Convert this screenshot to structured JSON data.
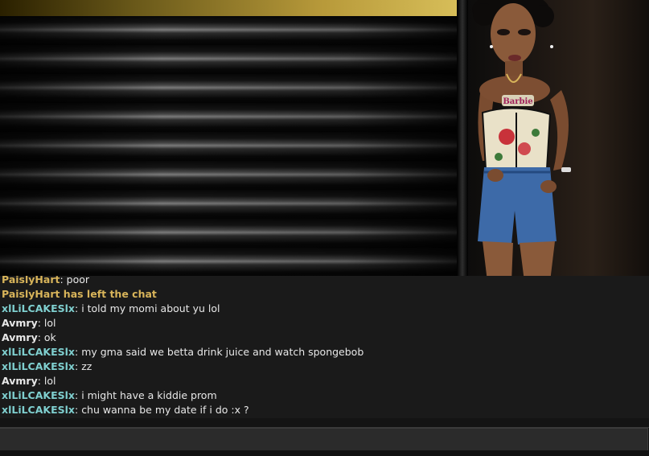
{
  "colors": {
    "name_xlil": "#7fcfcf",
    "name_avmry": "#e8e8e8",
    "name_paisly": "#d8b45a",
    "system": "#d8b45a",
    "message": "#e8e8e8"
  },
  "chat": {
    "messages": [
      {
        "name": "PaislyHart",
        "sep": ": ",
        "text": "poor",
        "color": "#d8b45a",
        "partial": true
      },
      {
        "system": "PaislyHart has left the chat"
      },
      {
        "name": "xlLiLCAKESlx",
        "sep": ": ",
        "text": "i told my momi about yu lol",
        "color": "#7fcfcf"
      },
      {
        "name": "Avmry",
        "sep": ": ",
        "text": "lol",
        "color": "#e8e8e8"
      },
      {
        "name": "Avmry",
        "sep": ": ",
        "text": "ok",
        "color": "#e8e8e8"
      },
      {
        "name": "xlLiLCAKESlx",
        "sep": ": ",
        "text": "my gma said we betta drink juice and watch spongebob",
        "color": "#7fcfcf"
      },
      {
        "name": "xlLiLCAKESlx",
        "sep": ": ",
        "text": "zz",
        "color": "#7fcfcf"
      },
      {
        "name": "Avmry",
        "sep": ": ",
        "text": "lol",
        "color": "#e8e8e8"
      },
      {
        "name": "xlLiLCAKESlx",
        "sep": ": ",
        "text": "i might have a kiddie prom",
        "color": "#7fcfcf"
      },
      {
        "name": "xlLiLCAKESlx",
        "sep": ": ",
        "text": "chu wanna be my date if i do :x ?",
        "color": "#7fcfcf"
      }
    ]
  },
  "avatar": {
    "necklace_text": "Barbie"
  },
  "input": {
    "value": ""
  }
}
